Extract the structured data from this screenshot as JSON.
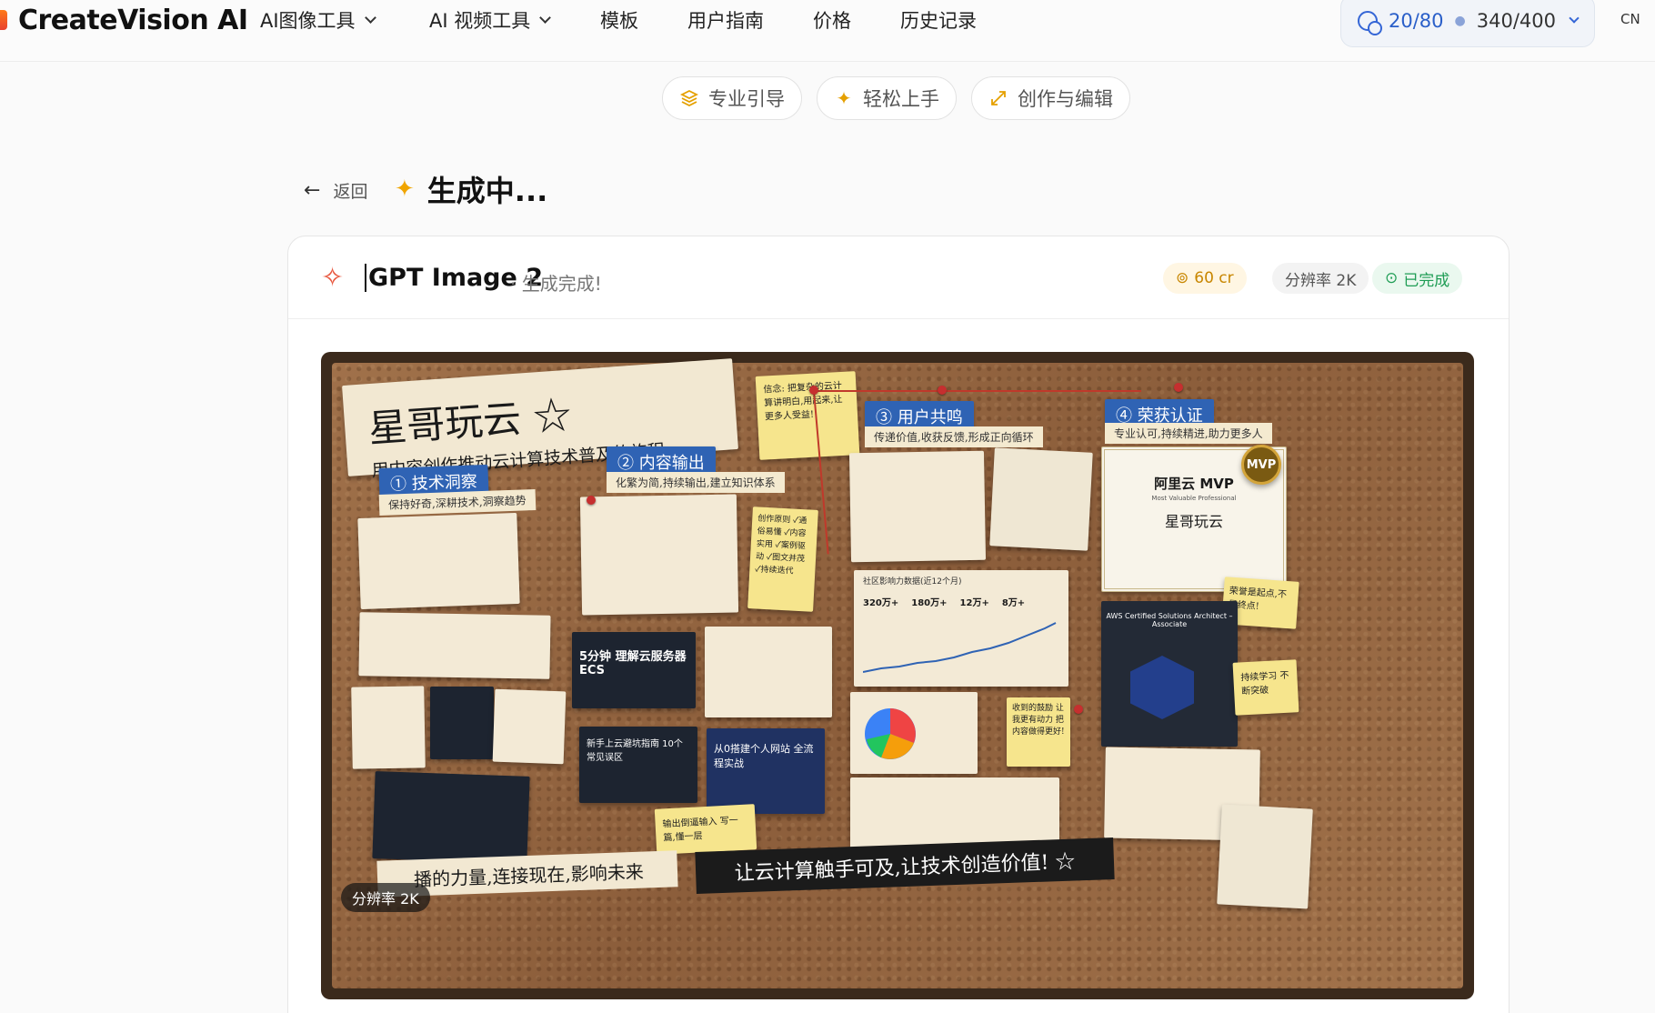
{
  "nav": {
    "brand": "CreateVision AI",
    "items": [
      {
        "label": "AI图像工具",
        "dropdown": true
      },
      {
        "label": "AI 视频工具",
        "dropdown": true
      },
      {
        "label": "模板",
        "dropdown": false
      },
      {
        "label": "用户指南",
        "dropdown": false
      },
      {
        "label": "价格",
        "dropdown": false
      },
      {
        "label": "历史记录",
        "dropdown": false
      }
    ],
    "credits_a": "20/80",
    "credits_b": "340/400",
    "lang": "CN"
  },
  "pills": [
    {
      "label": "专业引导",
      "icon": "layers-icon"
    },
    {
      "label": "轻松上手",
      "icon": "sparkle-icon"
    },
    {
      "label": "创作与编辑",
      "icon": "expand-icon"
    }
  ],
  "page": {
    "back_label": "返回",
    "title": "生成中..."
  },
  "card": {
    "model": "GPT Image 2",
    "status": "· 生成完成!",
    "cost": "60 cr",
    "resolution": "分辨率 2K",
    "done": "已完成"
  },
  "image": {
    "resolution_chip": "分辨率 2K",
    "title_main": "星哥玩云 ☆",
    "title_sub": "用内容创作推动云计算技术普及的旅程",
    "steps": [
      {
        "label": "① 技术洞察",
        "sub": "保持好奇,深耕技术,洞察趋势"
      },
      {
        "label": "② 内容输出",
        "sub": "化繁为简,持续输出,建立知识体系"
      },
      {
        "label": "③ 用户共鸣",
        "sub": "传递价值,收获反馈,形成正向循环"
      },
      {
        "label": "④ 荣获认证",
        "sub": "专业认可,持续精进,助力更多人"
      }
    ],
    "belief": "信念: 把复杂的云计算讲明白,用起来,让更多人受益!",
    "mvp_title": "阿里云 MVP",
    "mvp_sub": "Most Valuable Professional",
    "mvp_name": "星哥玩云",
    "video1": "5分钟 理解云服务器ECS",
    "video2": "新手上云避坑指南 10个常见误区",
    "video3": "从0搭建个人网站 全流程实战",
    "stats_title": "社区影响力数据(近12个月)",
    "stats": [
      "320万+",
      "180万+",
      "12万+",
      "8万+"
    ],
    "aws": "AWS Certified Solutions Architect – Associate",
    "slogan": "让云计算触手可及,让技术创造价值! ☆",
    "slogan2": "播的力量,连接现在,影响未来",
    "note_mvp": "荣誉是起点,不是终点!",
    "note_learn": "持续学习 不断突破",
    "note_feedback": "收到的鼓励 让我更有动力 把内容做得更好!",
    "note_output": "输出倒逼输入 写一篇,懂一层",
    "principles": "创作原则 ✓通俗易懂 ✓内容实用 ✓案例驱动 ✓图文并茂 ✓持续迭代"
  },
  "colors": {
    "accent": "#3566d6",
    "done": "#1f9d55",
    "cost": "#c88600"
  }
}
